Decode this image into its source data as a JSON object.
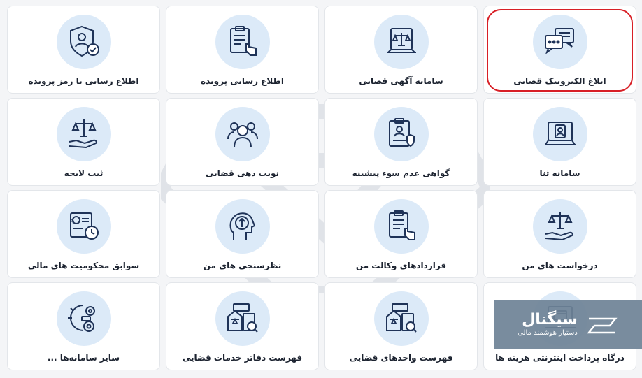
{
  "tiles": [
    {
      "label": "ابلاغ الکترونیک قضایی",
      "icon": "chat-bubbles-icon"
    },
    {
      "label": "سامانه آگهی قضایی",
      "icon": "laptop-scales-icon"
    },
    {
      "label": "اطلاع رسانی پرونده",
      "icon": "clipboard-touch-icon"
    },
    {
      "label": "اطلاع رسانی با رمز پرونده",
      "icon": "shield-user-check-icon"
    },
    {
      "label": "سامانه ثنا",
      "icon": "laptop-user-icon"
    },
    {
      "label": "گواهی عدم سوء پیشینه",
      "icon": "certificate-badge-icon"
    },
    {
      "label": "نوبت دهی قضایی",
      "icon": "people-group-icon"
    },
    {
      "label": "ثبت لایحه",
      "icon": "hand-scales-icon"
    },
    {
      "label": "درخواست های من",
      "icon": "hand-scales-icon"
    },
    {
      "label": "قراردادهای وکالت من",
      "icon": "clipboard-touch-icon"
    },
    {
      "label": "نظرسنجی های من",
      "icon": "head-arrow-icon"
    },
    {
      "label": "سوابق محکومیت های مالی",
      "icon": "money-clock-icon"
    },
    {
      "label": "درگاه پرداخت اینترنتی هزینه ها",
      "icon": "laptop-payment-icon"
    },
    {
      "label": "فهرست واحدهای قضایی",
      "icon": "building-search-icon"
    },
    {
      "label": "فهرست دفاتر خدمات قضایی",
      "icon": "building-search-icon"
    },
    {
      "label": "سایر سامانه‌ها ...",
      "icon": "gears-settings-icon"
    }
  ],
  "highlighted_tile": "ابلاغ الکترونیک قضایی",
  "brand": {
    "name": "سیگنال",
    "tagline": "دستیار هوشمند مالی",
    "icon": "signal-logo-icon"
  },
  "colors": {
    "icon_stroke": "#1f3358",
    "icon_bg": "#dceaf8",
    "highlight": "#d81f26"
  }
}
